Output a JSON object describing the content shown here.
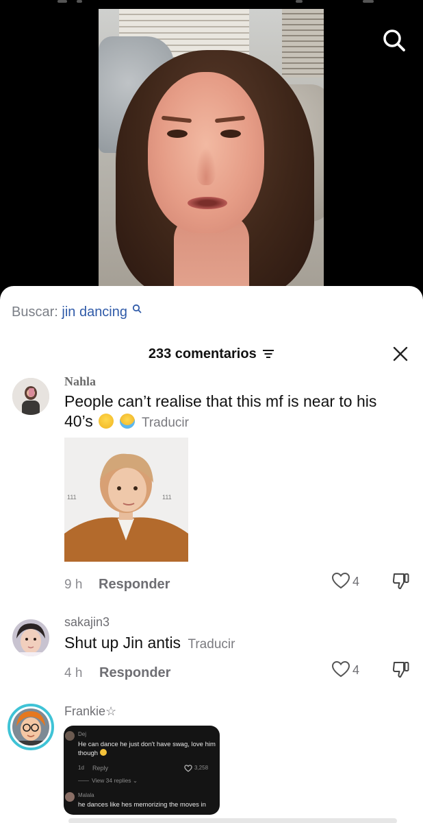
{
  "video": {
    "search_icon": "search-icon"
  },
  "sheet": {
    "search_prefix": "Buscar:",
    "search_term": "jin dancing",
    "comment_count": "233 comentarios",
    "sort_icon": "filter-lines-icon",
    "close_icon": "close-icon"
  },
  "comments": [
    {
      "username": "Nahla",
      "text": "People can’t realise that this mf is near to his 40’s",
      "emojis": [
        "laughing-face",
        "crying-face"
      ],
      "translate": "Traducir",
      "time": "9 h",
      "reply": "Responder",
      "likes": "4",
      "attachment": {
        "type": "image",
        "watermark": "111"
      }
    },
    {
      "username": "sakajin3",
      "text": "Shut up Jin antis",
      "translate": "Traducir",
      "time": "4 h",
      "reply": "Responder",
      "likes": "4"
    },
    {
      "username": "Frankie☆",
      "attachment": {
        "type": "screenshot",
        "entries": [
          {
            "user": "Dej",
            "text": "He can dance he just don't have swag, love him though",
            "age": "1d",
            "reply": "Reply",
            "likes": "3,258",
            "more": "View 34 replies"
          },
          {
            "user": "Malala",
            "text": "he dances like hes memorizing the moves in"
          }
        ]
      }
    }
  ],
  "colors": {
    "link": "#2f5aa8",
    "muted": "#7a7a7f",
    "sheet": "#ffffff",
    "accent_ring": "#3fc3d6"
  }
}
